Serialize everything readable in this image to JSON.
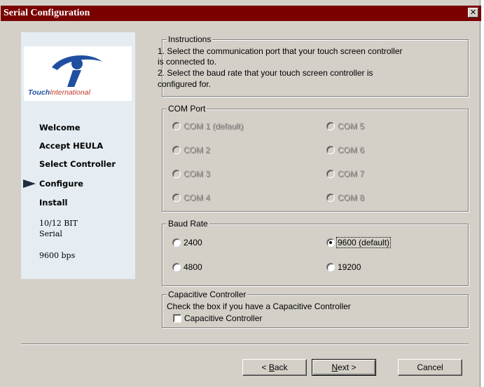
{
  "window": {
    "title": "Serial Configuration",
    "close_glyph": "✕"
  },
  "sidebar": {
    "logo": {
      "part1": "Touch",
      "part2": "International"
    },
    "steps": [
      {
        "label": "Welcome",
        "current": false
      },
      {
        "label": "Accept HEULA",
        "current": false
      },
      {
        "label": "Select Controller",
        "current": false
      },
      {
        "label": "Configure",
        "current": true
      },
      {
        "label": "Install",
        "current": false
      }
    ],
    "info": {
      "bits": "10/12 BIT",
      "interface": "Serial",
      "speed": "9600 bps"
    }
  },
  "instructions": {
    "legend": "Instructions",
    "line1": "1. Select the communication port that your touch screen controller",
    "line2": "is connected to.",
    "line3": "2. Select the baud rate that your touch screen controller is",
    "line4": "configured for."
  },
  "com_port": {
    "legend": "COM Port",
    "options": [
      "COM 1 (default)",
      "COM 5",
      "COM 2",
      "COM 6",
      "COM 3",
      "COM 7",
      "COM 4",
      "COM 8"
    ],
    "enabled": false
  },
  "baud_rate": {
    "legend": "Baud Rate",
    "options": [
      "2400",
      "9600 (default)",
      "4800",
      "19200"
    ],
    "selected": "9600 (default)"
  },
  "capacitive": {
    "legend": "Capacitive Controller",
    "description": "Check the box if you have a Capacitive Controller",
    "checkbox_label": "Capacitive Controller",
    "checked": false
  },
  "buttons": {
    "back_prefix": "< ",
    "back_accel": "B",
    "back_rest": "ack",
    "next_accel": "N",
    "next_rest": "ext >",
    "cancel": "Cancel"
  },
  "colors": {
    "titlebar": "#7a0000",
    "dialog": "#d4d0c8",
    "sidebar": "#e5edf3"
  }
}
